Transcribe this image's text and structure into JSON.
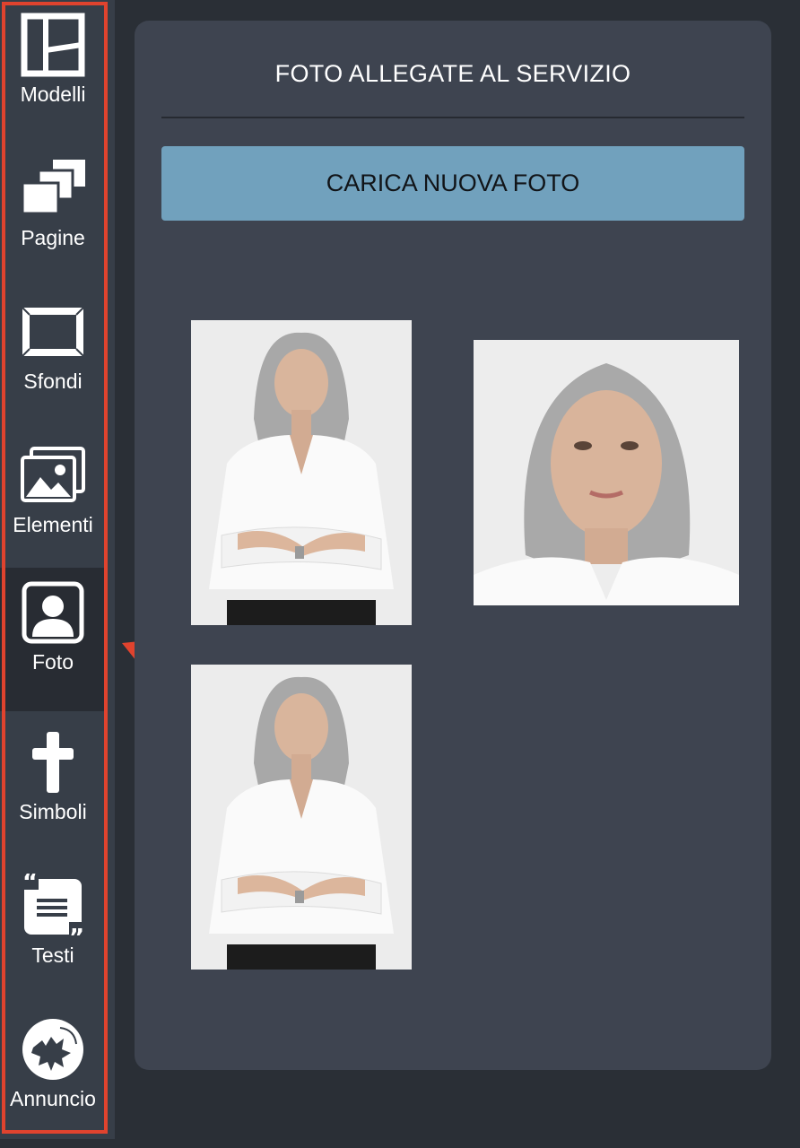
{
  "sidebar": {
    "items": [
      {
        "label": "Modelli",
        "icon": "layout-icon"
      },
      {
        "label": "Pagine",
        "icon": "pages-icon"
      },
      {
        "label": "Sfondi",
        "icon": "frame-icon"
      },
      {
        "label": "Elementi",
        "icon": "images-icon"
      },
      {
        "label": "Foto",
        "icon": "portrait-icon",
        "active": true
      },
      {
        "label": "Simboli",
        "icon": "cross-icon"
      },
      {
        "label": "Testi",
        "icon": "quote-text-icon"
      },
      {
        "label": "Annuncio",
        "icon": "leaf-badge-icon"
      }
    ]
  },
  "panel": {
    "title": "FOTO ALLEGATE AL SERVIZIO",
    "upload_label": "CARICA NUOVA FOTO",
    "photos": [
      {
        "subject": "woman-arms-crossed"
      },
      {
        "subject": "woman-portrait-closeup"
      },
      {
        "subject": "woman-arms-crossed"
      }
    ]
  },
  "colors": {
    "accent_button": "#71a1bd",
    "highlight": "#e0432e",
    "sidebar_bg": "#373e48",
    "panel_bg": "#3e4450"
  }
}
